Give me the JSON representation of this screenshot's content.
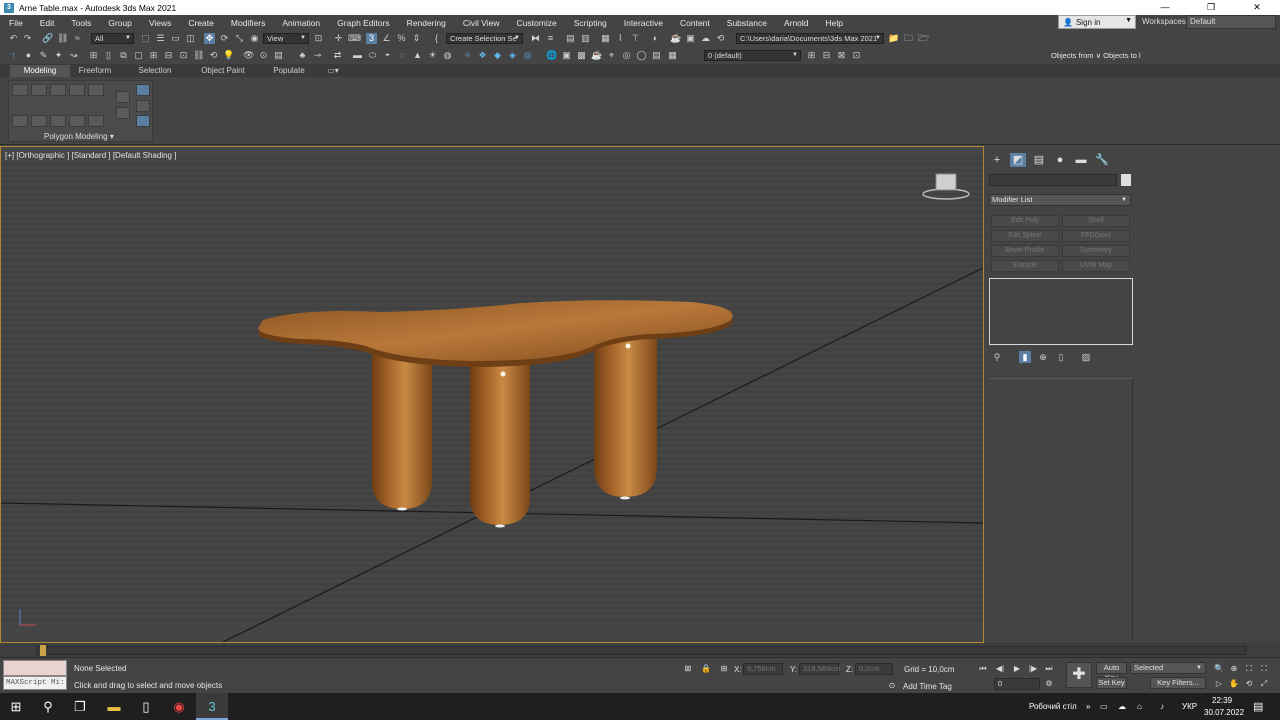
{
  "window": {
    "title": "Arne Table.max - Autodesk 3ds Max 2021",
    "controls": [
      "—",
      "❐",
      "✕"
    ]
  },
  "menu": [
    "File",
    "Edit",
    "Tools",
    "Group",
    "Views",
    "Create",
    "Modifiers",
    "Animation",
    "Graph Editors",
    "Rendering",
    "Civil View",
    "Customize",
    "Scripting",
    "Interactive",
    "Content",
    "Substance",
    "Arnold",
    "Help"
  ],
  "account": {
    "sign_in": "Sign in",
    "workspaces_label": "Workspaces:",
    "workspace": "Default"
  },
  "toolbar": {
    "filter": "All",
    "ref_coord": "View",
    "selection_set": "Create Selection Se",
    "project_path": "C:\\Users\\daria\\Documents\\3ds Max 2021",
    "layer": "0 (default)",
    "objects_hint": "Objects from ∨ Objects to l"
  },
  "ribbon": {
    "tabs": [
      "Modeling",
      "Freeform",
      "Selection",
      "Object Paint",
      "Populate"
    ],
    "active_tab": "Modeling",
    "panel_label": "Polygon Modeling"
  },
  "viewport": {
    "label": "[+] [Orthographic ] [Standard ] [Default Shading ]",
    "colors": {
      "border": "#b08b30",
      "wood": "#9a5e23",
      "background": "#444444"
    }
  },
  "command_panel": {
    "modifier_list": "Modifier List",
    "modifier_buttons": [
      "Edit Poly",
      "Shell",
      "Edit Spline",
      "FFD(box)",
      "Bevel Profile",
      "Symmetry",
      "Extrude",
      "UVW Map"
    ]
  },
  "status": {
    "maxscript": "MAXScript Mi:",
    "selection": "None Selected",
    "prompt": "Click and drag to select and move objects",
    "x_label": "X:",
    "x_value": "9,756cm",
    "y_label": "Y:",
    "y_value": "318,569cm",
    "z_label": "Z:",
    "z_value": "0,0cm",
    "grid": "Grid = 10,0cm",
    "add_time_tag": "Add Time Tag",
    "auto_key": "Auto Key",
    "set_key": "Set Key",
    "key_mode": "Selected",
    "key_filters": "Key Filters...",
    "frame": "0"
  },
  "taskbar": {
    "desktop_label": "Робочий стіл",
    "language": "УКР",
    "time": "22:39",
    "date": "30.07.2022"
  }
}
